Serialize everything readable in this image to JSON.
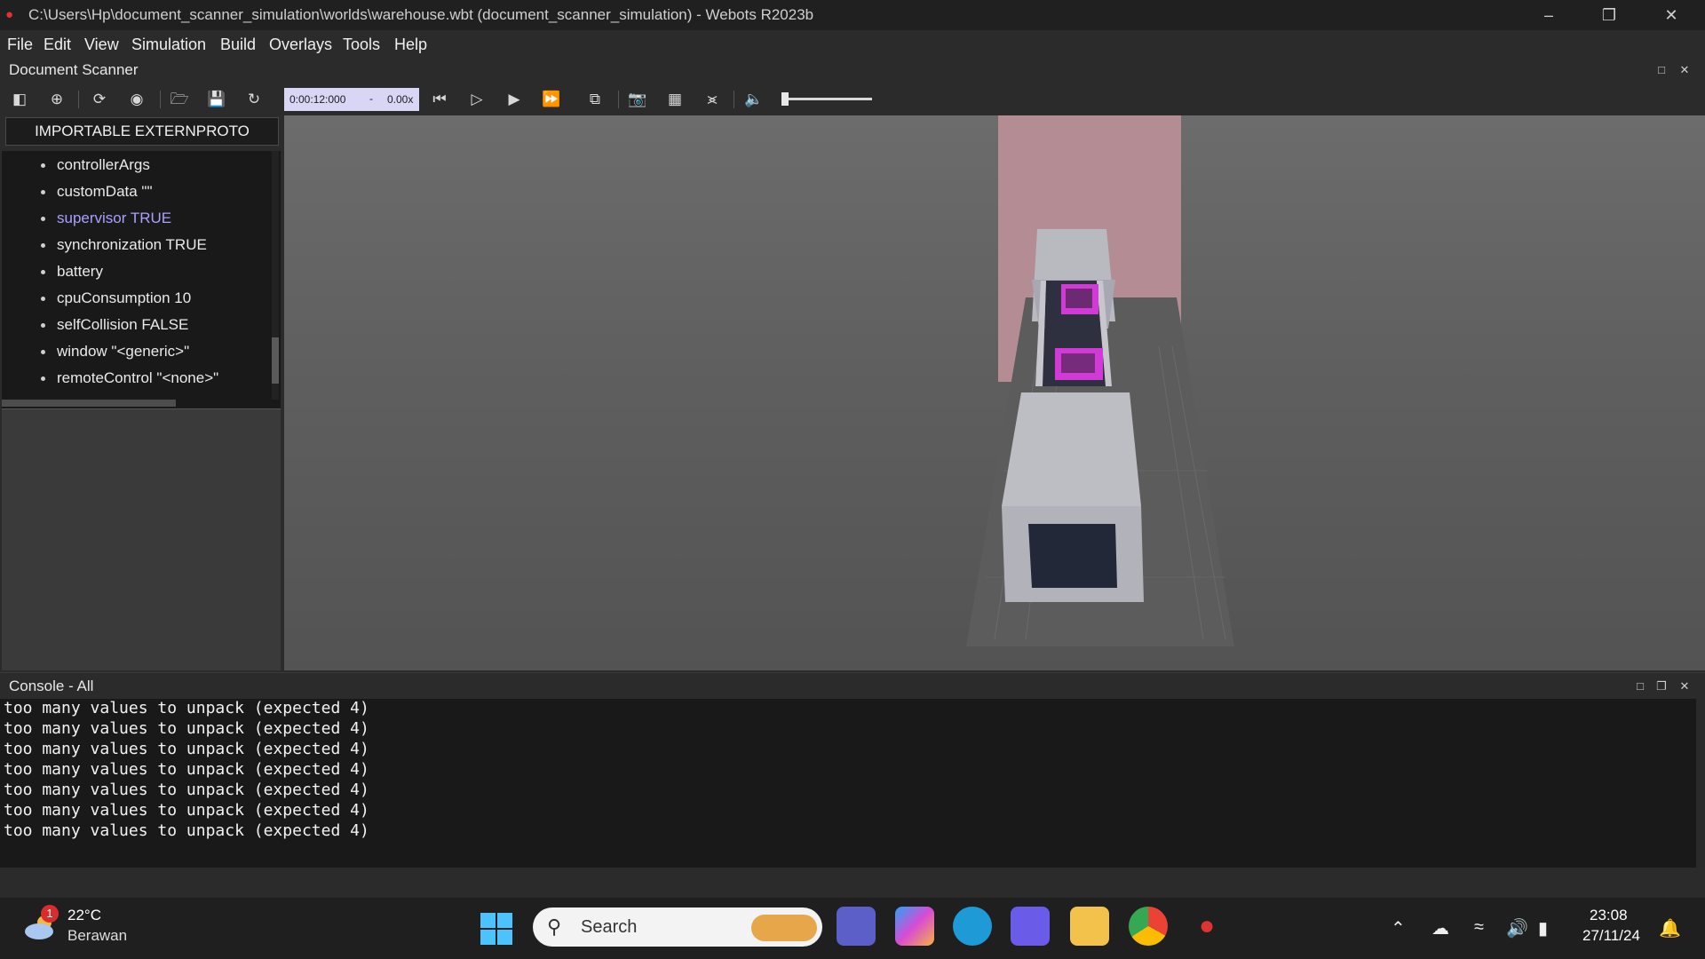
{
  "window": {
    "title": "C:\\Users\\Hp\\document_scanner_simulation\\worlds\\warehouse.wbt (document_scanner_simulation) - Webots R2023b",
    "app_icon": "webots-icon",
    "controls": [
      "minimize-icon",
      "restore-icon",
      "close-icon"
    ]
  },
  "menu": [
    "File",
    "Edit",
    "View",
    "Simulation",
    "Build",
    "Overlays",
    "Tools",
    "Help"
  ],
  "scene_tree_panel": {
    "title": "Document Scanner",
    "import_button": "IMPORTABLE EXTERNPROTO",
    "items": [
      "controllerArgs",
      "customData \"\"",
      "supervisor TRUE",
      "synchronization TRUE",
      "battery",
      "cpuConsumption 10",
      "selfCollision FALSE",
      "window \"<generic>\"",
      "remoteControl \"<none>\""
    ],
    "selected_index": 2
  },
  "toolbar": {
    "time": "0:00:12:000",
    "separator": "-",
    "speed": "0.00x",
    "volume_level": 0.02
  },
  "console": {
    "title": "Console - All",
    "lines": [
      "too many values to unpack (expected 4)",
      "too many values to unpack (expected 4)",
      "too many values to unpack (expected 4)",
      "too many values to unpack (expected 4)",
      "too many values to unpack (expected 4)",
      "too many values to unpack (expected 4)",
      "too many values to unpack (expected 4)"
    ]
  },
  "taskbar": {
    "weather_temp": "22°C",
    "weather_desc": "Berawan",
    "weather_badge": "1",
    "search_placeholder": "Search",
    "time": "23:08",
    "date": "27/11/24"
  },
  "colors": {
    "accent_time_box": "#d8d5f5",
    "selected_item": "#a9a0ff",
    "pink_wall": "#b48c93",
    "sticker_magenta": "#d23ad8"
  }
}
